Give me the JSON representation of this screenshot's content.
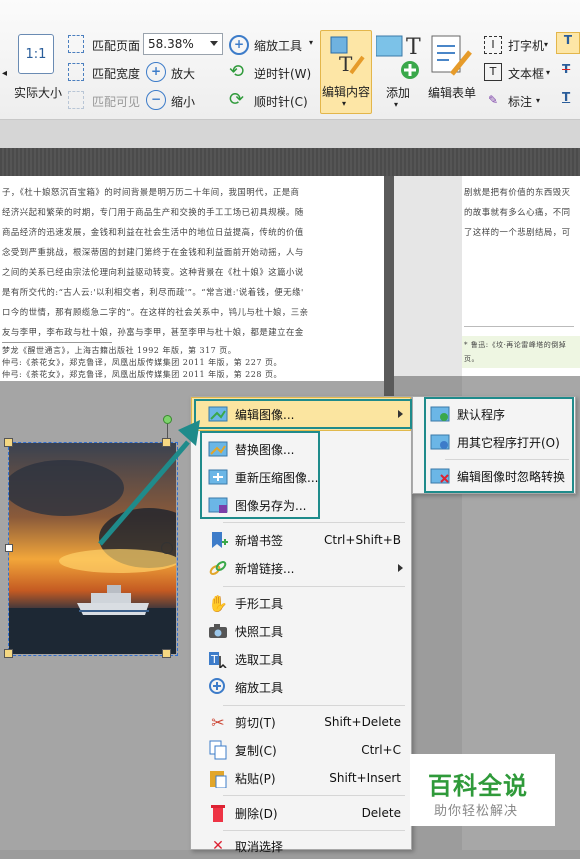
{
  "ribbon": {
    "actual_size": "实际大小",
    "fit_page": "匹配页面",
    "fit_width": "匹配宽度",
    "fit_visible": "匹配可见",
    "zoom_value": "58.38%",
    "zoom_tool": "缩放工具",
    "zoom_in": "放大",
    "zoom_out": "缩小",
    "rotate_ccw": "逆时针(W)",
    "rotate_cw": "顺时针(C)",
    "edit_content": "编辑内容",
    "add": "添加",
    "edit_form": "编辑表单",
    "typewriter": "打字机",
    "textbox": "文本框",
    "annotate": "标注"
  },
  "document": {
    "left_lines": [
      "子，《杜十娘怒沉百宝箱》的时间背景是明万历二十年间，我国明代，正是商",
      "经济兴起和繁荣的时期，专门用于商品生产和交换的手工工场已初具规模。随",
      "商品经济的迅速发展，金钱和利益在社会生活中的地位日益提高，传统的价值",
      "念受到严重挑战，根深蒂固的封建门第终于在金钱和利益面前开始动摇，人与",
      "之间的关系已经由宗法伦理向利益驱动转变。这种背景在《杜十娘》这篇小说",
      "是有所交代的:“古人云:'以利相交者，利尽而疏'”。“常言道:'说着钱，便无缘'",
      "ロ今的世情，那有顾缆急二字的”。在这样的社会关系中，鸨儿与杜十娘，三亲",
      "友与李甲，李布政与杜十娘，孙富与李甲，甚至李甲与杜十娘，都是建立在金"
    ],
    "footnotes": [
      "梦龙《醒世通言》，上海古籍出版社 1992 年版，第 317 页。",
      "仲弓:《茶花女》，郑克鲁译，凤凰出版传媒集团 2011 年版，第 227 页。",
      "仲弓:《茶花女》，郑克鲁译，凤凰出版传媒集团 2011 年版，第 228 页。"
    ],
    "right_lines": [
      "剧就是把有价值的东西毁灭",
      "的故事就有多么心痛，不同",
      "了这样的一个悲剧结局，可"
    ],
    "right_footnote_1": "* 鲁迅:《坟·再论雷峰塔的倒掉",
    "right_footnote_2": "页。"
  },
  "context_menu": {
    "items": [
      {
        "label": "编辑图像...",
        "shortcut": ""
      },
      {
        "label": "替换图像...",
        "shortcut": ""
      },
      {
        "label": "重新压缩图像...",
        "shortcut": ""
      },
      {
        "label": "图像另存为...",
        "shortcut": ""
      },
      {
        "label": "新增书签",
        "shortcut": "Ctrl+Shift+B"
      },
      {
        "label": "新增链接...",
        "shortcut": ""
      },
      {
        "label": "手形工具",
        "shortcut": ""
      },
      {
        "label": "快照工具",
        "shortcut": ""
      },
      {
        "label": "选取工具",
        "shortcut": ""
      },
      {
        "label": "缩放工具",
        "shortcut": ""
      },
      {
        "label": "剪切(T)",
        "shortcut": "Shift+Delete"
      },
      {
        "label": "复制(C)",
        "shortcut": "Ctrl+C"
      },
      {
        "label": "粘贴(P)",
        "shortcut": "Shift+Insert"
      },
      {
        "label": "删除(D)",
        "shortcut": "Delete"
      },
      {
        "label": "取消选择",
        "shortcut": ""
      }
    ]
  },
  "submenu": {
    "items": [
      {
        "label": "默认程序"
      },
      {
        "label": "用其它程序打开(O)"
      },
      {
        "label": "编辑图像时忽略转换"
      }
    ]
  },
  "watermark": {
    "title": "百科全说",
    "subtitle": "助你轻松解决"
  },
  "colors": {
    "highlight_teal": "#1f8b8b",
    "selected_tool": "#fde6a6",
    "menu_hover": "#fbe5a0"
  }
}
